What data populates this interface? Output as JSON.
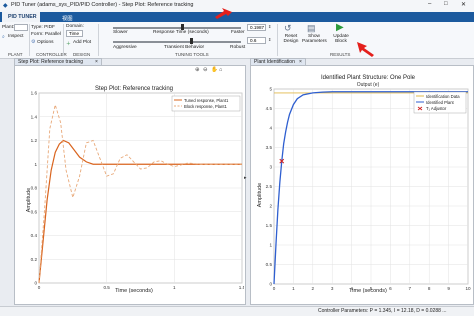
{
  "window": {
    "title": "PID Tuner (adams_sys_PID/PID Controller) - Step Plot: Reference tracking",
    "controls": [
      "–",
      "□",
      "✕"
    ]
  },
  "ribbon": {
    "tabs": [
      "PID TUNER",
      "视图"
    ],
    "plant_label": "Plant:",
    "plant_value": "",
    "inspect_label": "Inspect",
    "type_label": "Type: PIDF",
    "form_label": "Form: Parallel",
    "options_label": "Options",
    "domain_label": "Domain:",
    "domain_value": "Time",
    "add_plot_label": "Add Plot",
    "slow_label": "Slower",
    "fast_label": "Faster",
    "response_time_label": "Response Time (seconds)",
    "response_time_value": "0.1987",
    "aggressive_label": "Aggressive",
    "transient_label": "Transient Behavior",
    "robust_label": "Robust",
    "transient_value": "0.6",
    "reset_design_label": "Reset Design",
    "show_params_label": "Show Parameters",
    "update_block_label": "Update Block",
    "sections": [
      "PLANT",
      "CONTROLLER",
      "DESIGN",
      "TUNING TOOLS",
      "RESULTS"
    ]
  },
  "left_pane": {
    "tab_label": "Step Plot: Reference tracking",
    "tab_close": "×"
  },
  "right_pane": {
    "tab_label": "Plant Identification",
    "tab_close": "×"
  },
  "plot_tools": [
    "⊕",
    "⊖",
    "✋",
    "⌂"
  ],
  "step_chart": {
    "title": "Step Plot: Reference tracking",
    "xlabel": "Time (seconds)",
    "ylabel": "Amplitude",
    "xticks": [
      "0",
      "0.5",
      "1",
      "1.5"
    ],
    "yticks": [
      "0",
      "0.2",
      "0.4",
      "0.6",
      "0.8",
      "1",
      "1.2",
      "1.4",
      "1.6"
    ],
    "legend": [
      "Tuned response, Plant1",
      "Block response, Plant1"
    ]
  },
  "ident_chart": {
    "title": "Identified Plant Structure: One Pole",
    "subtitle": "Output (e)",
    "xlabel": "Time (seconds)",
    "ylabel": "Amplitude",
    "xticks": [
      "0",
      "1",
      "2",
      "3",
      "4",
      "5",
      "6",
      "7",
      "8",
      "9",
      "10"
    ],
    "yticks": [
      "0",
      "0.5",
      "1",
      "1.5",
      "2",
      "2.5",
      "3",
      "3.5",
      "4",
      "4.5",
      "5"
    ],
    "legend": [
      "Identification Data",
      "Identified Plant",
      "T₁ Adjustor"
    ]
  },
  "chart_data": [
    {
      "type": "line",
      "title": "Step Plot: Reference tracking",
      "xlabel": "Time (seconds)",
      "ylabel": "Amplitude",
      "xlim": [
        0,
        1.5
      ],
      "ylim": [
        0,
        1.6
      ],
      "series": [
        {
          "name": "Tuned response, Plant1",
          "color": "#d9641e",
          "style": "solid",
          "x": [
            0,
            0.03,
            0.06,
            0.09,
            0.12,
            0.15,
            0.18,
            0.22,
            0.26,
            0.3,
            0.35,
            0.4,
            0.5,
            0.6,
            0.8,
            1.0,
            1.2,
            1.5
          ],
          "y": [
            0,
            0.35,
            0.7,
            0.95,
            1.1,
            1.17,
            1.2,
            1.18,
            1.12,
            1.06,
            1.02,
            1.0,
            1.0,
            1.0,
            1.0,
            1.0,
            1.0,
            1.0
          ]
        },
        {
          "name": "Block response, Plant1",
          "color": "#e8a878",
          "style": "dashed",
          "x": [
            0,
            0.04,
            0.08,
            0.12,
            0.16,
            0.2,
            0.25,
            0.3,
            0.35,
            0.4,
            0.45,
            0.5,
            0.55,
            0.6,
            0.65,
            0.7,
            0.75,
            0.8,
            0.85,
            0.9,
            0.95,
            1.0,
            1.1,
            1.2,
            1.5
          ],
          "y": [
            0,
            0.6,
            1.3,
            1.5,
            1.35,
            0.95,
            0.72,
            0.9,
            1.18,
            1.2,
            1.05,
            0.9,
            0.92,
            1.05,
            1.08,
            1.02,
            0.96,
            0.97,
            1.02,
            1.03,
            1.0,
            0.98,
            1.01,
            1.0,
            1.0
          ]
        }
      ]
    },
    {
      "type": "line",
      "title": "Identified Plant Structure: One Pole",
      "xlabel": "Time (seconds)",
      "ylabel": "Amplitude",
      "xlim": [
        0,
        10
      ],
      "ylim": [
        0,
        5
      ],
      "series": [
        {
          "name": "Identification Data",
          "color": "#e0b84a",
          "x": [
            0,
            10
          ],
          "y": [
            4.9,
            4.9
          ]
        },
        {
          "name": "Identified Plant",
          "color": "#2f5fd0",
          "x": [
            0,
            0.1,
            0.2,
            0.3,
            0.4,
            0.5,
            0.6,
            0.7,
            0.8,
            1.0,
            1.2,
            1.5,
            2.0,
            2.5,
            3,
            4,
            5,
            10
          ],
          "y": [
            0,
            1.0,
            1.9,
            2.6,
            3.15,
            3.6,
            3.9,
            4.15,
            4.35,
            4.6,
            4.75,
            4.85,
            4.9,
            4.92,
            4.93,
            4.93,
            4.93,
            4.93
          ]
        },
        {
          "name": "T₁ Adjustor",
          "color": "#d02020",
          "x": [
            0.4
          ],
          "y": [
            3.15
          ],
          "marker": "x"
        }
      ]
    }
  ],
  "status": {
    "text": "Controller Parameters: P = 1.345, I = 12.18, D = 0.0288 ..."
  }
}
